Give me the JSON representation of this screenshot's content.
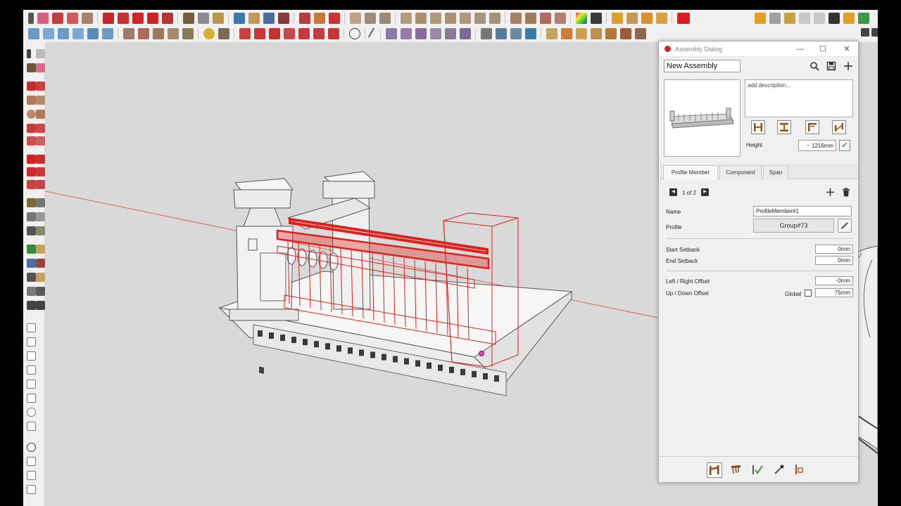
{
  "dialog": {
    "title": "Assembly Dialog",
    "assembly_name": "New Assembly",
    "description_placeholder": "add description...",
    "height_label": "Height",
    "height_value": "~ 1216mm",
    "tabs": [
      {
        "label": "Profile Member"
      },
      {
        "label": "Component"
      },
      {
        "label": "Span"
      }
    ],
    "page_indicator": "1 of 2",
    "fields": {
      "name_label": "Name",
      "name_value": "ProfileMember#1",
      "profile_label": "Profile",
      "profile_value": "Group#73",
      "start_setback_label": "Start Setback",
      "start_setback_value": "0mm",
      "end_setback_label": "End Setback",
      "end_setback_value": "0mm",
      "lr_offset_label": "Left / Right Offset",
      "lr_offset_value": "-0mm",
      "ud_offset_label": "Up / Down Offset",
      "global_label": "Global",
      "ud_offset_value": "75mm"
    }
  },
  "colors": {
    "accent_red": "#e0201c",
    "viewport_bg": "#d9d9d9",
    "dialog_bg": "#f0f0f0",
    "check_green": "#3aa23a"
  }
}
